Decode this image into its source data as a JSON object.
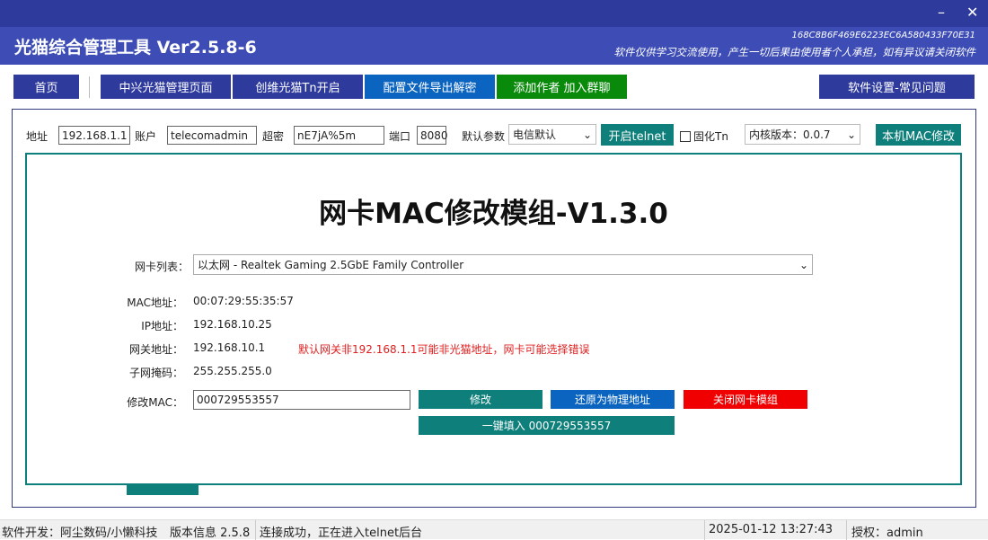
{
  "window": {
    "title": "光猫综合管理工具 Ver2.5.8-6",
    "machine_code": "168C8B6F469E6223EC6A580433F70E31",
    "disclaimer": "软件仅供学习交流使用，产生一切后果由使用者个人承担，如有异议请关闭软件",
    "minimize": "–",
    "close": "✕"
  },
  "nav": {
    "home": "首页",
    "zte": "中兴光猫管理页面",
    "skyworth": "创维光猫Tn开启",
    "config": "配置文件导出解密",
    "add_author": "添加作者 加入群聊",
    "settings": "软件设置-常见问题"
  },
  "conn": {
    "addr_label": "地址",
    "addr": "192.168.1.1",
    "account_label": "账户",
    "account": "telecomadmin",
    "pwd_label": "超密",
    "pwd": "nE7jA%5m",
    "port_label": "端口",
    "port": "8080",
    "default_label": "默认参数",
    "default_value": "电信默认",
    "telnet_button": "开启telnet",
    "fix_tn": "固化Tn",
    "kernel": "内核版本：0.0.7",
    "mac_button": "本机MAC修改"
  },
  "module": {
    "title": "网卡MAC修改模组-V1.3.0",
    "nic_label": "网卡列表：",
    "nic_value": "以太网 - Realtek Gaming 2.5GbE Family Controller",
    "mac_label": "MAC地址：",
    "mac": "00:07:29:55:35:57",
    "ip_label": "IP地址：",
    "ip": "192.168.10.25",
    "gw_label": "网关地址：",
    "gw": "192.168.10.1",
    "gw_warning": "默认网关非192.168.1.1可能非光猫地址，网卡可能选择错误",
    "mask_label": "子网掩码：",
    "mask": "255.255.255.0",
    "modify_label": "修改MAC：",
    "modify_value": "000729553557",
    "modify_button": "修改",
    "restore_button": "还原为物理地址",
    "close_button": "关闭网卡模组",
    "fill_button": "一键填入 000729553557"
  },
  "status": {
    "dev": "软件开发：阿尘数码/小懒科技",
    "version": "版本信息  2.5.8",
    "message": "连接成功，正在进入telnet后台",
    "time": "2025-01-12 13:27:43",
    "auth": "授权：admin"
  }
}
